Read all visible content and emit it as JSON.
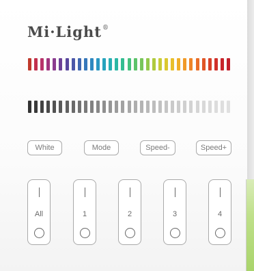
{
  "brand": {
    "name": "Mi·Light",
    "mark": "®"
  },
  "color_bar": {
    "colors": [
      "#c0392b",
      "#c2304d",
      "#b8336a",
      "#a0357f",
      "#8a3c8f",
      "#6d4196",
      "#59479d",
      "#4a57a8",
      "#3f67b1",
      "#3577ba",
      "#2e88c0",
      "#2a97c2",
      "#27a3bd",
      "#27aeb3",
      "#2ab7a4",
      "#33bd91",
      "#44c07d",
      "#5cc36a",
      "#78c55a",
      "#94c84b",
      "#b0ca3e",
      "#c8cb35",
      "#dbc82f",
      "#e8bf2b",
      "#efae29",
      "#f19a28",
      "#ee8427",
      "#e96d26",
      "#e15626",
      "#d84128",
      "#d0302a",
      "#c8252b",
      "#c1202c"
    ]
  },
  "gray_bar": {
    "colors": [
      "#333333",
      "#3a3a3a",
      "#424242",
      "#4a4a4a",
      "#525252",
      "#5a5a5a",
      "#626262",
      "#6a6a6a",
      "#727272",
      "#797979",
      "#818181",
      "#888888",
      "#8f8f8f",
      "#969696",
      "#9c9c9c",
      "#a2a2a2",
      "#a8a8a8",
      "#aeaeae",
      "#b3b3b3",
      "#b8b8b8",
      "#bdbdbd",
      "#c1c1c1",
      "#c5c5c5",
      "#c9c9c9",
      "#cccccc",
      "#cfcfcf",
      "#d2d2d2",
      "#d5d5d5",
      "#d8d8d8",
      "#dadada",
      "#dcdcdc",
      "#dedede",
      "#e0e0e0"
    ]
  },
  "buttons": {
    "white": "White",
    "mode": "Mode",
    "speed_down": "Speed-",
    "speed_up": "Speed+"
  },
  "zones": [
    {
      "label": "All"
    },
    {
      "label": "1"
    },
    {
      "label": "2"
    },
    {
      "label": "3"
    },
    {
      "label": "4"
    }
  ]
}
